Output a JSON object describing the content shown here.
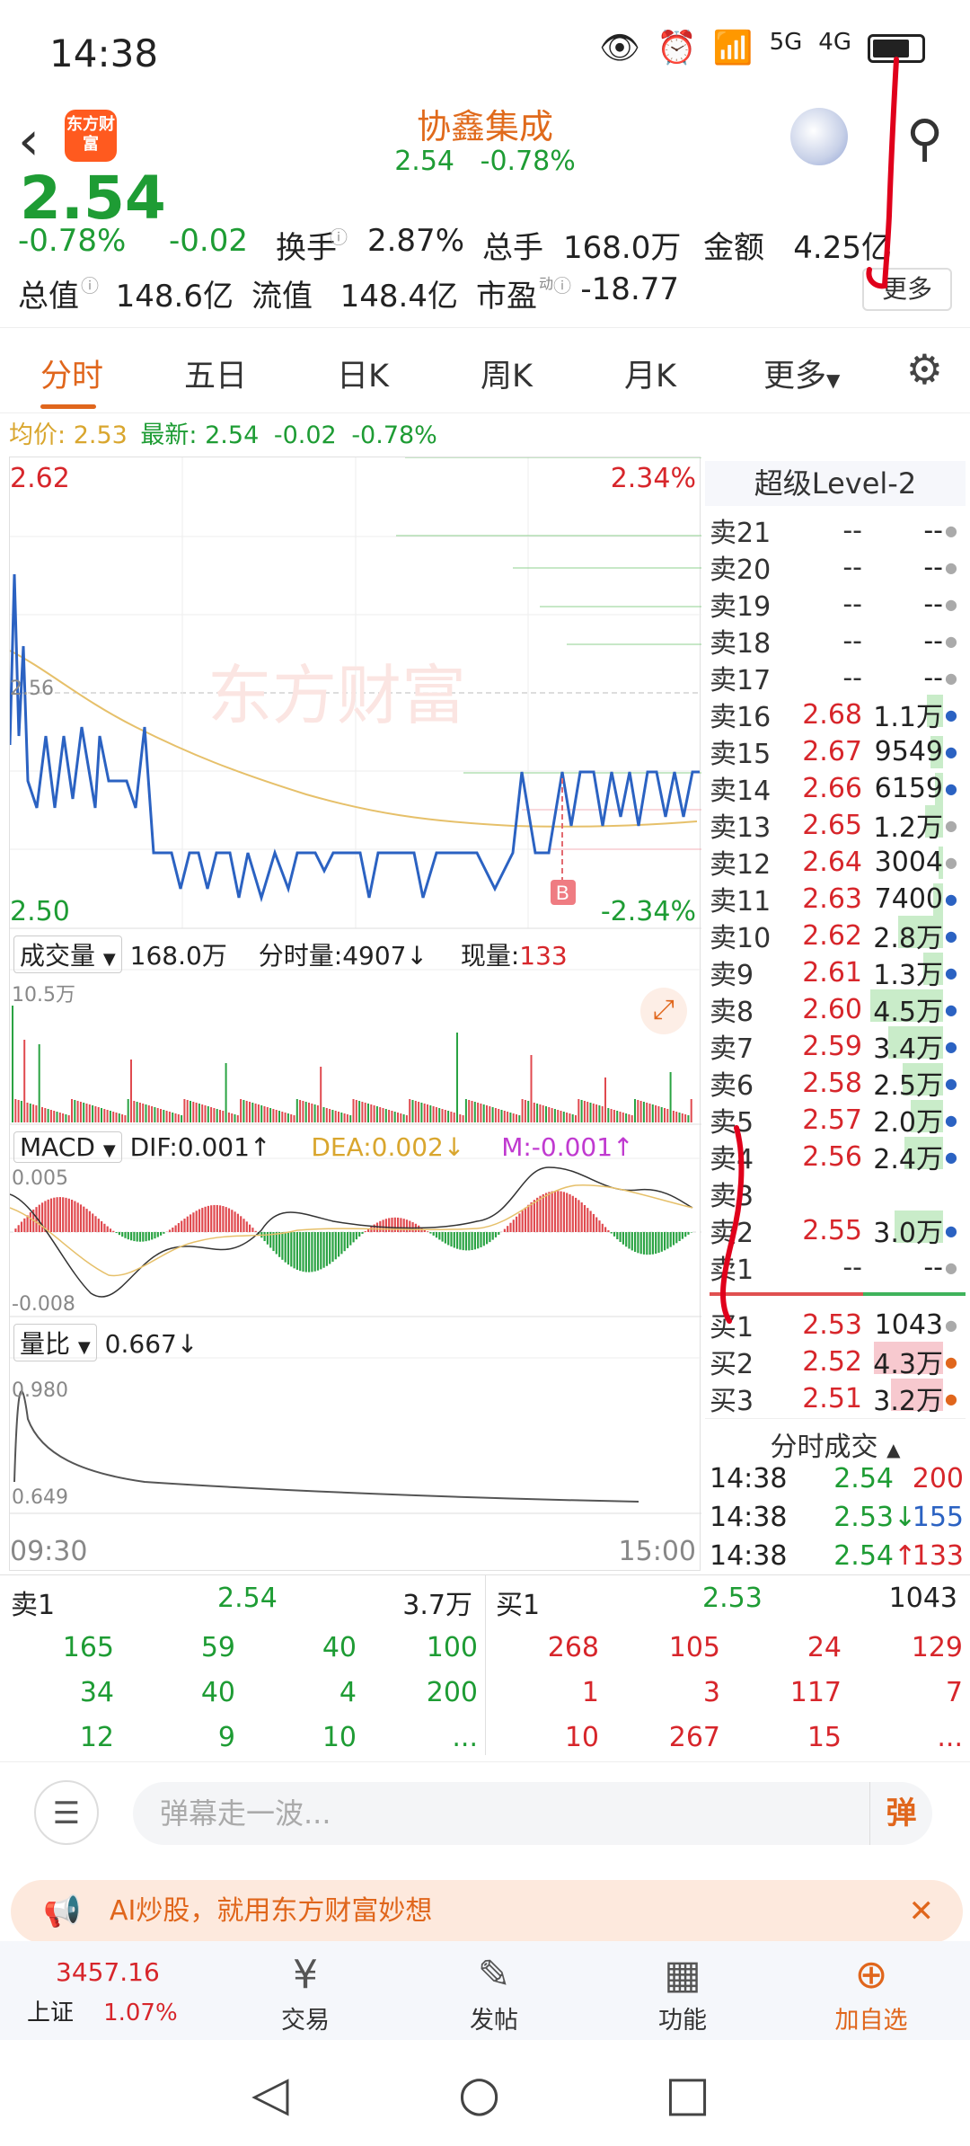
{
  "status_bar": {
    "time": "14:38",
    "icons": [
      "eye-icon",
      "alarm-icon",
      "wifi-icon",
      "5g-signal-icon",
      "4g-signal-icon",
      "battery-icon"
    ],
    "net1": "5G",
    "net2": "4G"
  },
  "header": {
    "logo_text": "东方财富",
    "title": "协鑫集成",
    "price": "2.54",
    "change_pct": "-0.78%"
  },
  "quote": {
    "big_price": "2.54",
    "change_pct": "-0.78%",
    "change": "-0.02",
    "turnover_label": "换手",
    "turnover": "2.87%",
    "total_hand_label": "总手",
    "total_hand": "168.0万",
    "amount_label": "金额",
    "amount": "4.25亿",
    "mcap_label": "总值",
    "mcap": "148.6亿",
    "float_label": "流值",
    "float": "148.4亿",
    "pe_label": "市盈",
    "pe_sup": "动",
    "pe": "-18.77",
    "more": "更多"
  },
  "tabs": {
    "items": [
      "分时",
      "五日",
      "日K",
      "周K",
      "月K",
      "更多"
    ],
    "active": 0
  },
  "avgline": {
    "avg_label": "均价:",
    "avg": "2.53",
    "latest_label": "最新:",
    "latest": "2.54",
    "chg": "-0.02",
    "pct": "-0.78%"
  },
  "chart": {
    "price_high": "2.62",
    "price_low": "2.50",
    "pct_high": "2.34%",
    "pct_low": "-2.34%",
    "mid_label": "2.56",
    "watermark": "东方财富",
    "b_marker": "B",
    "vol_header": {
      "label": "成交量",
      "total": "168.0万",
      "fen_label": "分时量:",
      "fen": "4907",
      "now_label": "现量:",
      "now": "133",
      "max": "10.5万"
    },
    "macd_header": {
      "label": "MACD",
      "dif": "DIF:0.001",
      "dea": "DEA:0.002",
      "m": "M:-0.001",
      "top": "0.005",
      "bottom": "-0.008"
    },
    "lb_header": {
      "label": "量比",
      "value": "0.667",
      "top": "0.980",
      "bottom": "0.649"
    },
    "time_start": "09:30",
    "time_end": "15:00"
  },
  "order_book": {
    "title": "超级Level-2",
    "sells": [
      {
        "label": "卖21",
        "price": "--",
        "vol": "--",
        "bar": 0,
        "dot": "gray"
      },
      {
        "label": "卖20",
        "price": "--",
        "vol": "--",
        "bar": 0,
        "dot": "gray"
      },
      {
        "label": "卖19",
        "price": "--",
        "vol": "--",
        "bar": 0,
        "dot": "gray"
      },
      {
        "label": "卖18",
        "price": "--",
        "vol": "--",
        "bar": 0,
        "dot": "gray"
      },
      {
        "label": "卖17",
        "price": "--",
        "vol": "--",
        "bar": 0,
        "dot": "gray"
      },
      {
        "label": "卖16",
        "price": "2.68",
        "vol": "1.1万",
        "bar": 0.2,
        "dot": "blue"
      },
      {
        "label": "卖15",
        "price": "2.67",
        "vol": "9549",
        "bar": 0.15,
        "dot": "blue"
      },
      {
        "label": "卖14",
        "price": "2.66",
        "vol": "6159",
        "bar": 0.1,
        "dot": "blue"
      },
      {
        "label": "卖13",
        "price": "2.65",
        "vol": "1.2万",
        "bar": 0.22,
        "dot": "gray"
      },
      {
        "label": "卖12",
        "price": "2.64",
        "vol": "3004",
        "bar": 0.05,
        "dot": "gray"
      },
      {
        "label": "卖11",
        "price": "2.63",
        "vol": "7400",
        "bar": 0.12,
        "dot": "blue"
      },
      {
        "label": "卖10",
        "price": "2.62",
        "vol": "2.8万",
        "bar": 0.55,
        "dot": "blue"
      },
      {
        "label": "卖9",
        "price": "2.61",
        "vol": "1.3万",
        "bar": 0.24,
        "dot": "blue"
      },
      {
        "label": "卖8",
        "price": "2.60",
        "vol": "4.5万",
        "bar": 0.9,
        "dot": "blue"
      },
      {
        "label": "卖7",
        "price": "2.59",
        "vol": "3.4万",
        "bar": 0.68,
        "dot": "blue"
      },
      {
        "label": "卖6",
        "price": "2.58",
        "vol": "2.5万",
        "bar": 0.5,
        "dot": "blue"
      },
      {
        "label": "卖5",
        "price": "2.57",
        "vol": "2.0万",
        "bar": 0.4,
        "dot": "blue"
      },
      {
        "label": "卖4",
        "price": "2.56",
        "vol": "2.4万",
        "bar": 0.48,
        "dot": "blue"
      },
      {
        "label": "卖3",
        "price": "",
        "vol": "",
        "bar": 0,
        "dot": ""
      },
      {
        "label": "卖2",
        "price": "2.55",
        "vol": "3.0万",
        "bar": 0.6,
        "dot": "blue"
      },
      {
        "label": "卖1",
        "price": "--",
        "vol": "--",
        "bar": 0,
        "dot": "gray"
      }
    ],
    "buys": [
      {
        "label": "买1",
        "price": "2.53",
        "vol": "1043",
        "bar": 0,
        "dot": "gray"
      },
      {
        "label": "买2",
        "price": "2.52",
        "vol": "4.3万",
        "bar": 0.86,
        "dot": "orange"
      },
      {
        "label": "买3",
        "price": "2.51",
        "vol": "3.2万",
        "bar": 0.64,
        "dot": "orange"
      }
    ],
    "ticks_title": "分时成交",
    "ticks": [
      {
        "time": "14:38",
        "price": "2.54",
        "arrow": "",
        "vol": "200",
        "color": "red"
      },
      {
        "time": "14:38",
        "price": "2.53",
        "arrow": "↓",
        "vol": "155",
        "color": "blue"
      },
      {
        "time": "14:38",
        "price": "2.54",
        "arrow": "↑",
        "vol": "133",
        "color": "red"
      }
    ]
  },
  "level1": {
    "sell": {
      "label": "卖1",
      "price": "2.54",
      "vol": "3.7万",
      "rows": [
        [
          "165",
          "59",
          "40",
          "100"
        ],
        [
          "34",
          "40",
          "4",
          "200"
        ],
        [
          "12",
          "9",
          "10",
          "..."
        ]
      ]
    },
    "buy": {
      "label": "买1",
      "price": "2.53",
      "vol": "1043",
      "rows": [
        [
          "268",
          "105",
          "24",
          "129"
        ],
        [
          "1",
          "3",
          "117",
          "7"
        ],
        [
          "10",
          "267",
          "15",
          "..."
        ]
      ]
    }
  },
  "comment": {
    "placeholder": "弹幕走一波...",
    "danmu": "弹"
  },
  "ad": {
    "text": "AI炒股，就用东方财富妙想"
  },
  "nav": {
    "index_value": "3457.16",
    "index_name": "上证",
    "index_pct": "1.07%",
    "items": [
      {
        "label": "交易",
        "icon": "yuan-cycle-icon"
      },
      {
        "label": "发帖",
        "icon": "edit-icon"
      },
      {
        "label": "功能",
        "icon": "grid-icon"
      },
      {
        "label": "加自选",
        "icon": "add-circle-icon"
      }
    ]
  },
  "colors": {
    "up": "#d7262b",
    "down": "#1e9c34",
    "accent": "#e0661c",
    "line": "#2b62c2",
    "avg": "#e6c06a"
  }
}
